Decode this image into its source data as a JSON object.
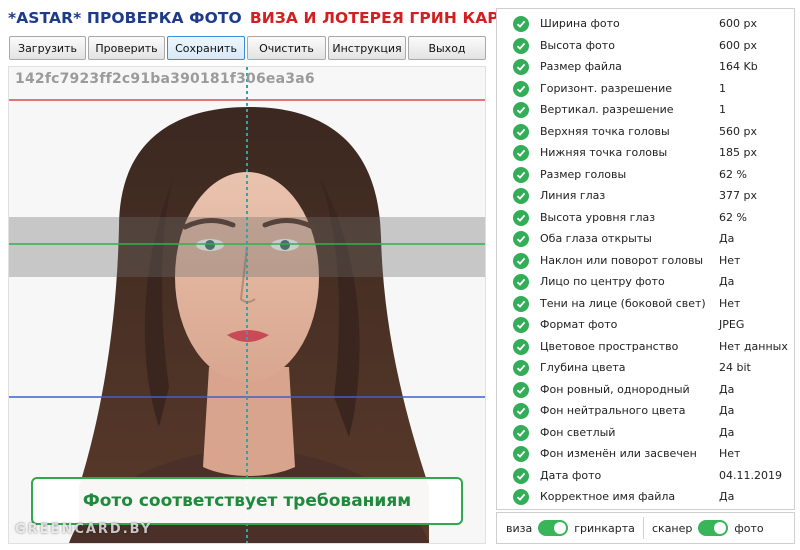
{
  "header": {
    "title_part1": "*ASTAR* ПРОВЕРКА ФОТО",
    "title_part2": "ВИЗА И ЛОТЕРЕЯ ГРИН КАРТА"
  },
  "toolbar": {
    "buttons": [
      {
        "label": "Загрузить"
      },
      {
        "label": "Проверить"
      },
      {
        "label": "Сохранить",
        "active": true
      },
      {
        "label": "Очистить"
      },
      {
        "label": "Инструкция"
      },
      {
        "label": "Выход"
      }
    ]
  },
  "photo": {
    "hash": "142fc7923ff2c91ba390181f306ea3a6",
    "result_text": "Фото соответствует требованиям",
    "watermark": "GREENCARD.BY",
    "guide_colors": {
      "top": "#d94a4a",
      "eye": "#2fb04f",
      "chin": "#3f5fd0",
      "center": "#3aa0a0"
    }
  },
  "checks": [
    {
      "label": "Ширина фото",
      "value": "600 px"
    },
    {
      "label": "Высота фото",
      "value": "600 px"
    },
    {
      "label": "Размер файла",
      "value": "164 Kb"
    },
    {
      "label": "Горизонт. разрешение",
      "value": "1"
    },
    {
      "label": "Вертикал. разрешение",
      "value": "1"
    },
    {
      "label": "Верхняя точка головы",
      "value": "560 px"
    },
    {
      "label": "Нижняя точка головы",
      "value": "185 px"
    },
    {
      "label": "Размер головы",
      "value": "62 %"
    },
    {
      "label": "Линия глаз",
      "value": "377 px"
    },
    {
      "label": "Высота уровня глаз",
      "value": "62 %"
    },
    {
      "label": "Оба глаза открыты",
      "value": "Да"
    },
    {
      "label": "Наклон или поворот головы",
      "value": "Нет"
    },
    {
      "label": "Лицо по центру фото",
      "value": "Да"
    },
    {
      "label": "Тени на лице (боковой свет)",
      "value": "Нет"
    },
    {
      "label": "Формат фото",
      "value": "JPEG"
    },
    {
      "label": "Цветовое пространство",
      "value": "Нет данных"
    },
    {
      "label": "Глубина цвета",
      "value": "24 bit"
    },
    {
      "label": "Фон ровный, однородный",
      "value": "Да"
    },
    {
      "label": "Фон нейтрального цвета",
      "value": "Да"
    },
    {
      "label": "Фон светлый",
      "value": "Да"
    },
    {
      "label": "Фон изменён или засвечен",
      "value": "Нет"
    },
    {
      "label": "Дата фото",
      "value": "04.11.2019"
    },
    {
      "label": "Корректное имя файла",
      "value": "Да"
    }
  ],
  "toggles": {
    "visa_label": "виза",
    "greencard_label": "гринкарта",
    "scanner_label": "сканер",
    "photo_label": "фото",
    "mode_selected": "гринкарта",
    "source_selected": "фото"
  },
  "colors": {
    "accent": "#33ad57",
    "title_blue": "#1e3a8a",
    "title_red": "#d21f1f"
  }
}
